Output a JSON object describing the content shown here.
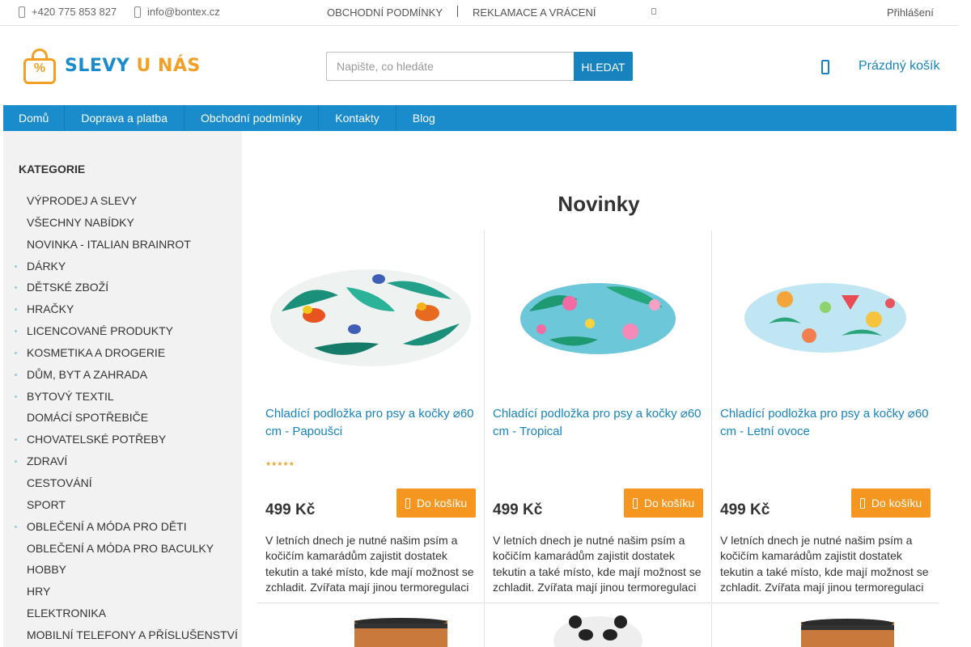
{
  "topbar": {
    "phone": "+420 775 853 827",
    "email": "info@bontex.cz",
    "links": [
      "OBCHODNÍ PODMÍNKY",
      "REKLAMACE A VRÁCENÍ"
    ],
    "login": "Přihlášení"
  },
  "logo": {
    "word1": "SLEVY",
    "word2": "U NÁS",
    "symbol": "%"
  },
  "search": {
    "placeholder": "Napište, co hledáte",
    "button": "HLEDAT"
  },
  "cart": {
    "label": "Prázdný košík"
  },
  "nav": {
    "items": [
      "Domů",
      "Doprava a platba",
      "Obchodní podmínky",
      "Kontakty",
      "Blog"
    ]
  },
  "sidebar": {
    "heading": "KATEGORIE",
    "items": [
      {
        "label": "VÝPRODEJ A SLEVY",
        "has_children": false
      },
      {
        "label": "VŠECHNY NABÍDKY",
        "has_children": false
      },
      {
        "label": "NOVINKA - ITALIAN BRAINROT",
        "has_children": false
      },
      {
        "label": "DÁRKY",
        "has_children": true
      },
      {
        "label": "DĚTSKÉ ZBOŽÍ",
        "has_children": true
      },
      {
        "label": "HRAČKY",
        "has_children": true
      },
      {
        "label": "LICENCOVANÉ PRODUKTY",
        "has_children": true
      },
      {
        "label": "KOSMETIKA A DROGERIE",
        "has_children": true
      },
      {
        "label": "DŮM, BYT A ZAHRADA",
        "has_children": true
      },
      {
        "label": "BYTOVÝ TEXTIL",
        "has_children": true
      },
      {
        "label": "DOMÁCÍ SPOTŘEBIČE",
        "has_children": false
      },
      {
        "label": "CHOVATELSKÉ POTŘEBY",
        "has_children": true
      },
      {
        "label": "ZDRAVÍ",
        "has_children": true
      },
      {
        "label": "CESTOVÁNÍ",
        "has_children": false
      },
      {
        "label": "SPORT",
        "has_children": false
      },
      {
        "label": "OBLEČENÍ A MÓDA PRO DĚTI",
        "has_children": true
      },
      {
        "label": "OBLEČENÍ A MÓDA PRO BACULKY",
        "has_children": false
      },
      {
        "label": "HOBBY",
        "has_children": false
      },
      {
        "label": "HRY",
        "has_children": false
      },
      {
        "label": "ELEKTRONIKA",
        "has_children": false
      },
      {
        "label": "MOBILNÍ TELEFONY A PŘÍSLUŠENSTVÍ",
        "has_children": false
      }
    ]
  },
  "main": {
    "title": "Novinky"
  },
  "products": [
    {
      "name": "Chladící podložka pro psy a kočky ⌀60 cm - Papoušci",
      "price": "499 Kč",
      "rating_stars": 5,
      "buy_label": "Do košíku",
      "description": "V letních dnech je nutné našim psím a kočičím kamarádům zajistit dostatek tekutin a také místo, kde mají možnost se zchladit. Zvířata mají jinou termoregulaci",
      "pattern": "parrots"
    },
    {
      "name": "Chladící podložka pro psy a kočky ⌀60 cm - Tropical",
      "price": "499 Kč",
      "buy_label": "Do košíku",
      "description": "V letních dnech je nutné našim psím a kočičím kamarádům zajistit dostatek tekutin a také místo, kde mají možnost se zchladit. Zvířata mají jinou termoregulaci",
      "pattern": "tropical"
    },
    {
      "name": "Chladící podložka pro psy a kočky ⌀60 cm - Letní ovoce",
      "price": "499 Kč",
      "buy_label": "Do košíku",
      "description": "V letních dnech je nutné našim psím a kočičím kamarádům zajistit dostatek tekutin a také místo, kde mají možnost se zchladit. Zvířata mají jinou termoregulaci",
      "pattern": "fruit"
    }
  ],
  "colors": {
    "brand_blue": "#1a8ccb",
    "link_blue": "#1783be",
    "accent_orange": "#f4961f",
    "sidebar_bg": "#f2f2f2"
  }
}
